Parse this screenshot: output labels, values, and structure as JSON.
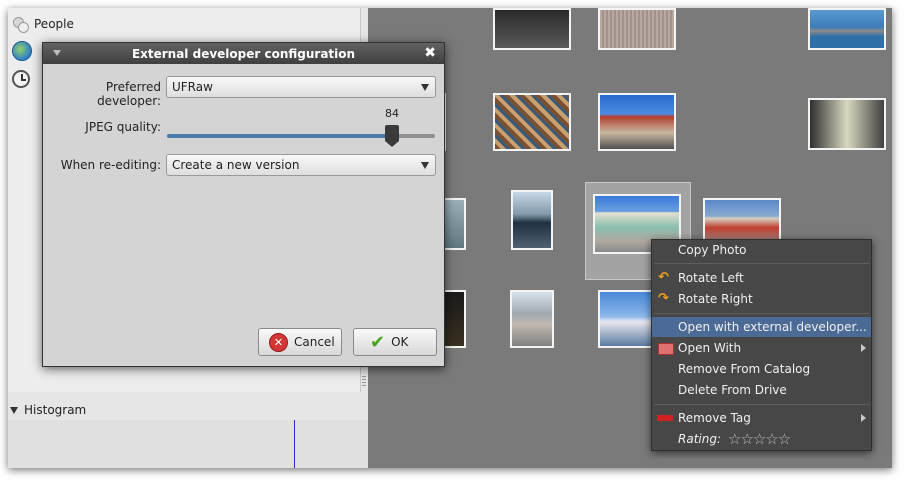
{
  "sidebar": {
    "items": [
      {
        "label": "People",
        "icon": "people-icon"
      },
      {
        "label": "",
        "icon": "globe-icon"
      },
      {
        "label": "",
        "icon": "clock-icon"
      }
    ],
    "histogram_label": "Histogram"
  },
  "dialog": {
    "title": "External developer configuration",
    "preferred_developer_label": "Preferred developer:",
    "preferred_developer_value": "UFRaw",
    "jpeg_quality_label": "JPEG quality:",
    "jpeg_quality_value": "84",
    "jpeg_quality_fraction": 0.84,
    "reedit_label": "When re-editing:",
    "reedit_value": "Create a new version",
    "cancel_label": "Cancel",
    "ok_label": "OK"
  },
  "context_menu": {
    "items": [
      {
        "label": "Copy Photo"
      },
      {
        "label": "Rotate Left"
      },
      {
        "label": "Rotate Right"
      },
      {
        "label": "Open with external developer..."
      },
      {
        "label": "Open With"
      },
      {
        "label": "Remove From Catalog"
      },
      {
        "label": "Delete From Drive"
      },
      {
        "label": "Remove Tag"
      }
    ],
    "rating_label": "Rating:",
    "rating_stars": "☆☆☆☆☆",
    "highlight_color": "#4b6b96"
  },
  "colors": {
    "canvas": "#7a7a7a",
    "menu_bg": "#474747",
    "slider_fill": "#4a7bb0"
  }
}
